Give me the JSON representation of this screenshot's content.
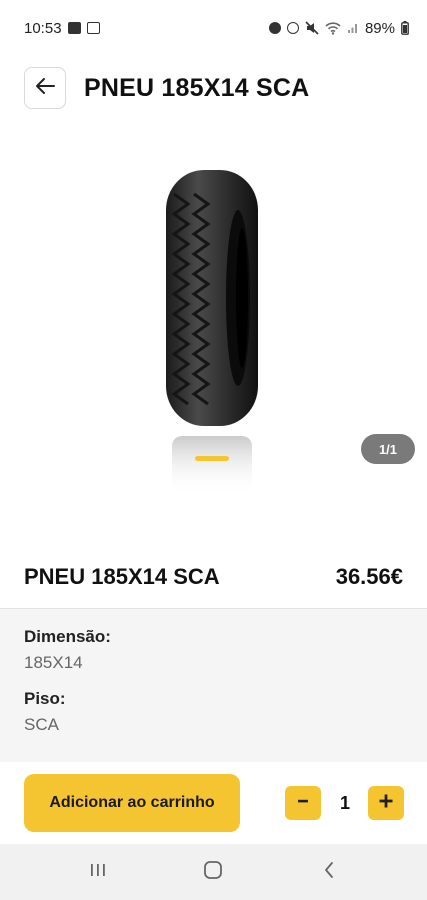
{
  "status_bar": {
    "time": "10:53",
    "battery": "89%"
  },
  "header": {
    "title": "PNEU 185X14 SCA"
  },
  "gallery": {
    "counter": "1/1",
    "indicator_color": "#f5c431"
  },
  "product": {
    "name": "PNEU 185X14 SCA",
    "price": "36.56€"
  },
  "specs": [
    {
      "label": "Dimensão:",
      "value": "185X14"
    },
    {
      "label": "Piso:",
      "value": "SCA"
    }
  ],
  "actions": {
    "add_to_cart_label": "Adicionar ao carrinho",
    "quantity": "1",
    "minus_icon": "minus-icon",
    "plus_icon": "plus-icon"
  },
  "colors": {
    "accent": "#f5c431",
    "specs_background": "#f5f5f5",
    "counter_background": "#7a7a7a"
  }
}
